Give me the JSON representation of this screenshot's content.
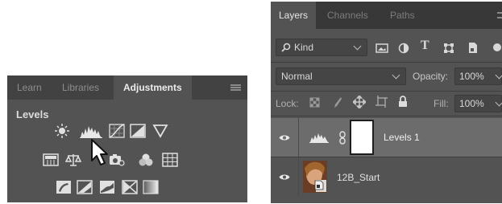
{
  "adjustments_panel": {
    "tabs": [
      "Learn",
      "Libraries",
      "Adjustments"
    ],
    "active_tab": "Adjustments",
    "title": "Levels",
    "icons_row1": [
      "brightness-contrast-icon",
      "levels-icon",
      "curves-icon",
      "exposure-icon",
      "vibrance-icon"
    ],
    "icons_row2": [
      "hue-saturation-icon",
      "color-balance-icon",
      "black-white-icon",
      "photo-filter-icon",
      "channel-mixer-icon",
      "color-lookup-icon"
    ],
    "icons_row3": [
      "invert-icon",
      "posterize-icon",
      "threshold-icon",
      "selective-color-icon",
      "gradient-map-icon"
    ],
    "hovered_icon": "levels-icon"
  },
  "layers_panel": {
    "tabs": [
      "Layers",
      "Channels",
      "Paths"
    ],
    "active_tab": "Layers",
    "filter": {
      "label": "Kind"
    },
    "blend_mode": "Normal",
    "opacity": {
      "label": "Opacity:",
      "value": "100%"
    },
    "lock": {
      "label": "Lock:"
    },
    "fill": {
      "label": "Fill:",
      "value": "100%"
    },
    "layers": [
      {
        "name": "Levels 1",
        "selected": true,
        "visible": true
      },
      {
        "name": "12B_Start",
        "selected": false,
        "visible": true
      }
    ]
  }
}
